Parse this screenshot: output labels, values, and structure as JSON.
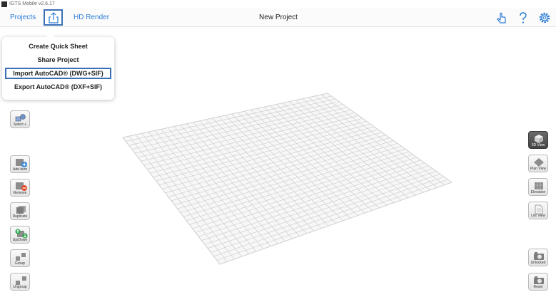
{
  "window": {
    "title": "IGTS Mobile v2.6.17"
  },
  "toolbar": {
    "projects": "Projects",
    "hd_render": "HD Render",
    "title": "New Project",
    "accent_color": "#2a7ad6"
  },
  "menu": {
    "items": [
      "Create Quick Sheet",
      "Share Project",
      "Import AutoCAD® (DWG+SIF)",
      "Export AutoCAD® (DXF+SIF)"
    ],
    "selected_index": 2
  },
  "left_buttons": [
    {
      "label": "Select +",
      "icon": "select-shapes-icon"
    },
    {
      "label": "Add Item",
      "icon": "add-item-icon"
    },
    {
      "label": "Remove",
      "icon": "remove-item-icon"
    },
    {
      "label": "Duplicate",
      "icon": "duplicate-icon"
    },
    {
      "label": "Up/Down",
      "icon": "up-down-icon"
    },
    {
      "label": "Group",
      "icon": "group-icon"
    },
    {
      "label": "Ungroup",
      "icon": "ungroup-icon"
    }
  ],
  "right_buttons": [
    {
      "label": "3D View",
      "icon": "cube-icon",
      "active": true
    },
    {
      "label": "Plan View",
      "icon": "plan-view-icon",
      "active": false
    },
    {
      "label": "Elevation",
      "icon": "elevation-icon",
      "active": false
    },
    {
      "label": "List View",
      "icon": "list-view-icon",
      "active": false
    },
    {
      "label": "Unlocked",
      "icon": "camera-unlocked-icon",
      "active": false
    },
    {
      "label": "Reset",
      "icon": "camera-reset-icon",
      "active": false
    }
  ],
  "top_right_icons": [
    "hand-pointer-icon",
    "help-icon",
    "settings-gear-icon"
  ]
}
